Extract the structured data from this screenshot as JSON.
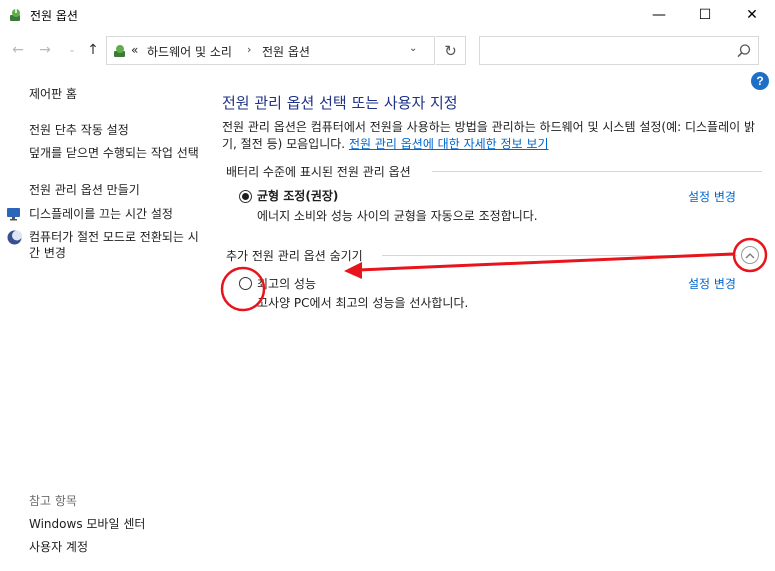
{
  "window": {
    "title": "전원 옵션",
    "minimize_glyph": "—",
    "maximize_glyph": "☐",
    "close_glyph": "✕"
  },
  "nav": {
    "back_glyph": "←",
    "forward_glyph": "→",
    "recent_glyph": "⌄",
    "up_glyph": "↑",
    "breadcrumb": {
      "overflow": "«",
      "item1": "하드웨어 및 소리",
      "separator": "›",
      "item2": "전원 옵션"
    },
    "dropdown_glyph": "⌄",
    "refresh_glyph": "↻",
    "search_placeholder": ""
  },
  "help": {
    "glyph": "?"
  },
  "sidebar": {
    "home": "제어판 홈",
    "links": [
      "전원 단추 작동 설정",
      "덮개를 닫으면 수행되는 작업 선택",
      "전원 관리 옵션 만들기",
      "디스플레이를 끄는 시간 설정",
      "컴퓨터가 절전 모드로 전환되는 시간 변경"
    ],
    "see_also_header": "참고 항목",
    "see_also": [
      "Windows 모바일 센터",
      "사용자 계정"
    ]
  },
  "main": {
    "title": "전원 관리 옵션 선택 또는 사용자 지정",
    "description": "전원 관리 옵션은 컴퓨터에서 전원을 사용하는 방법을 관리하는 하드웨어 및 시스템 설정(예: 디스플레이 밝기, 절전 등) 모음입니다.",
    "description_link": "전원 관리 옵션에 대한 자세한 정보 보기",
    "battery_group_label": "배터리 수준에 표시된 전원 관리 옵션",
    "plans": [
      {
        "name": "균형 조정(권장)",
        "description": "에너지 소비와 성능 사이의 균형을 자동으로 조정합니다.",
        "selected": true,
        "settings_link": "설정 변경"
      }
    ],
    "hidden_group_label": "추가 전원 관리 옵션 숨기기",
    "hidden_plans": [
      {
        "name": "최고의 성능",
        "description": "고사양 PC에서 최고의 성능을 선사합니다.",
        "selected": false,
        "settings_link": "설정 변경"
      }
    ],
    "collapse_glyph": "︿"
  },
  "annotation": {
    "color": "#e8141c"
  }
}
